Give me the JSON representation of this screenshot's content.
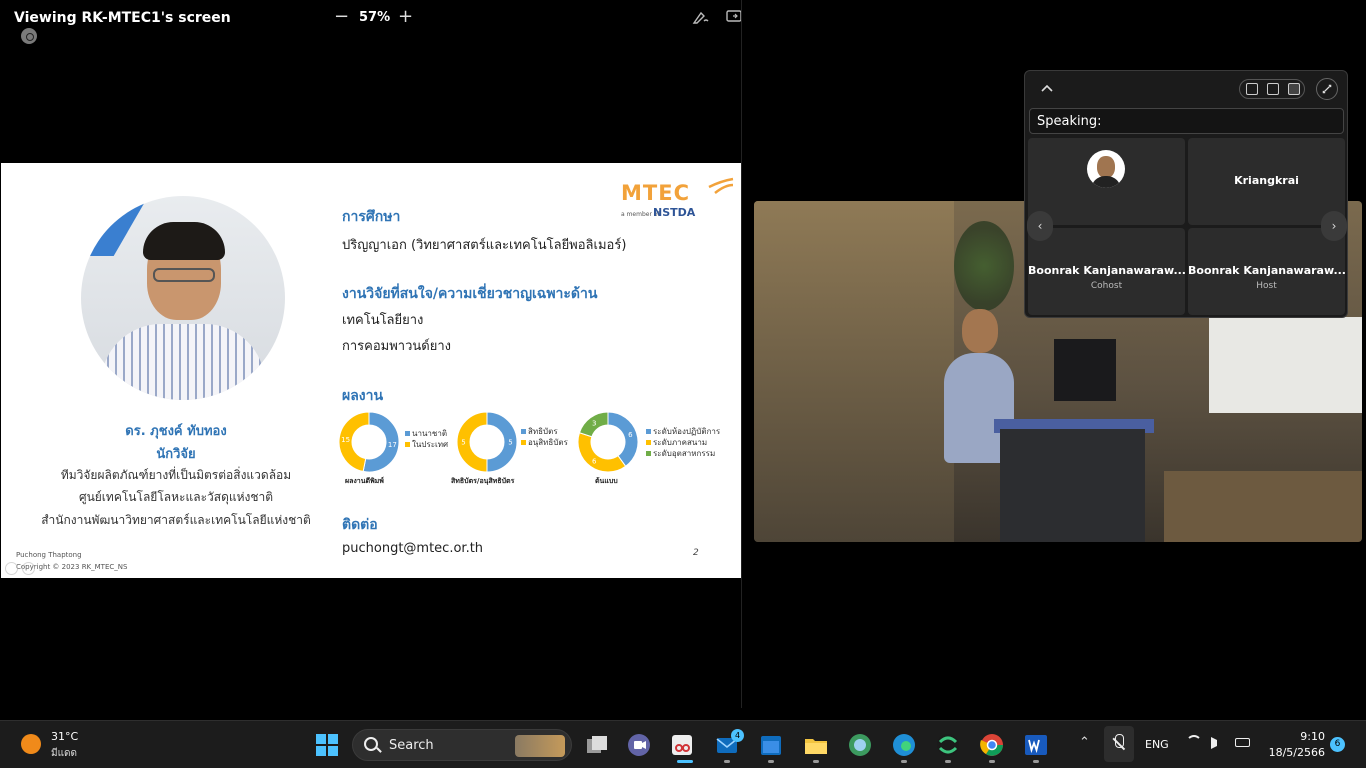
{
  "share": {
    "title": "Viewing RK-MTEC1's screen",
    "zoom_minus": "−",
    "zoom_level": "57%",
    "zoom_plus": "+"
  },
  "slide": {
    "logo_text": "MTEC",
    "logo_sub": "a member of",
    "logo_nstda": "NSTDA",
    "person_name": "ดร. ภุชงค์ ทับทอง",
    "person_role": "นักวิจัย",
    "person_lines": [
      "ทีมวิจัยผลิตภัณฑ์ยางที่เป็นมิตรต่อสิ่งแวดล้อม",
      "ศูนย์เทคโนโลยีโลหะและวัสดุแห่งชาติ",
      "สำนักงานพัฒนาวิทยาศาสตร์และเทคโนโลยีแห่งชาติ"
    ],
    "author": "Puchong Thaptong",
    "copyright": "Copyright © 2023  RK_MTEC_NS",
    "sections": {
      "education_h": "การศึกษา",
      "education_t": "ปริญญาเอก (วิทยาศาสตร์และเทคโนโลยีพอลิเมอร์)",
      "research_h": "งานวิจัยที่สนใจ/ความเชี่ยวชาญเฉพาะด้าน",
      "research_t1": "เทคโนโลยียาง",
      "research_t2": "การคอมพาวนด์ยาง",
      "works_h": "ผลงาน",
      "contact_h": "ติดต่อ",
      "contact_t": "puchongt@mtec.or.th"
    },
    "page_number": "2"
  },
  "chart_data": [
    {
      "type": "pie",
      "title": "ผลงานตีพิมพ์",
      "categories": [
        "นานาชาติ",
        "ในประเทศ"
      ],
      "values": [
        17,
        15
      ],
      "colors": [
        "#5b9bd5",
        "#ffc000"
      ]
    },
    {
      "type": "pie",
      "title": "สิทธิบัตร/อนุสิทธิบัตร",
      "categories": [
        "สิทธิบัตร",
        "อนุสิทธิบัตร"
      ],
      "values": [
        5,
        5
      ],
      "colors": [
        "#5b9bd5",
        "#ffc000"
      ]
    },
    {
      "type": "pie",
      "title": "ต้นแบบ",
      "categories": [
        "ระดับห้องปฏิบัติการ",
        "ระดับภาคสนาม",
        "ระดับอุตสาหกรรม"
      ],
      "values": [
        6,
        6,
        3
      ],
      "colors": [
        "#5b9bd5",
        "#ffc000",
        "#70ad47"
      ]
    }
  ],
  "panel": {
    "speaking_label": "Speaking:",
    "tiles": [
      {
        "name": "",
        "role": ""
      },
      {
        "name": "Kriangkrai",
        "role": ""
      },
      {
        "name": "Boonrak Kanjanawaraw...",
        "role": "Cohost"
      },
      {
        "name": "Boonrak Kanjanawaraw...",
        "role": "Host"
      }
    ],
    "nav_prev": "‹",
    "nav_next": "›"
  },
  "taskbar": {
    "weather_temp": "31°C",
    "weather_desc": "มีแดด",
    "search_label": "Search",
    "mail_badge": "4",
    "language": "ENG",
    "time": "9:10",
    "date": "18/5/2566",
    "notification_count": "6"
  }
}
